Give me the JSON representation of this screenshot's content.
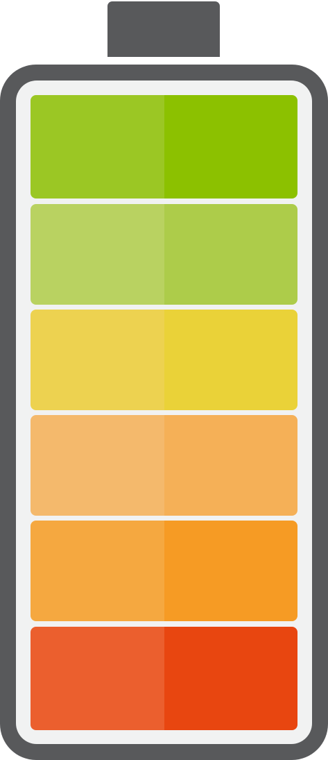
{
  "battery": {
    "charge_level": 1.0,
    "segment_count": 6,
    "frame_color": "#58595b",
    "inner_color": "#f1f2f2",
    "segments": [
      {
        "name": "cell-1",
        "light": "#9bc724",
        "dark": "#8cc100"
      },
      {
        "name": "cell-2",
        "light": "#b9d261",
        "dark": "#adcc4a"
      },
      {
        "name": "cell-3",
        "light": "#edd250",
        "dark": "#ead238"
      },
      {
        "name": "cell-4",
        "light": "#f4b96c",
        "dark": "#f5b057"
      },
      {
        "name": "cell-5",
        "light": "#f5a840",
        "dark": "#f69b24"
      },
      {
        "name": "cell-6",
        "light": "#eb5f2e",
        "dark": "#e84610"
      }
    ]
  }
}
